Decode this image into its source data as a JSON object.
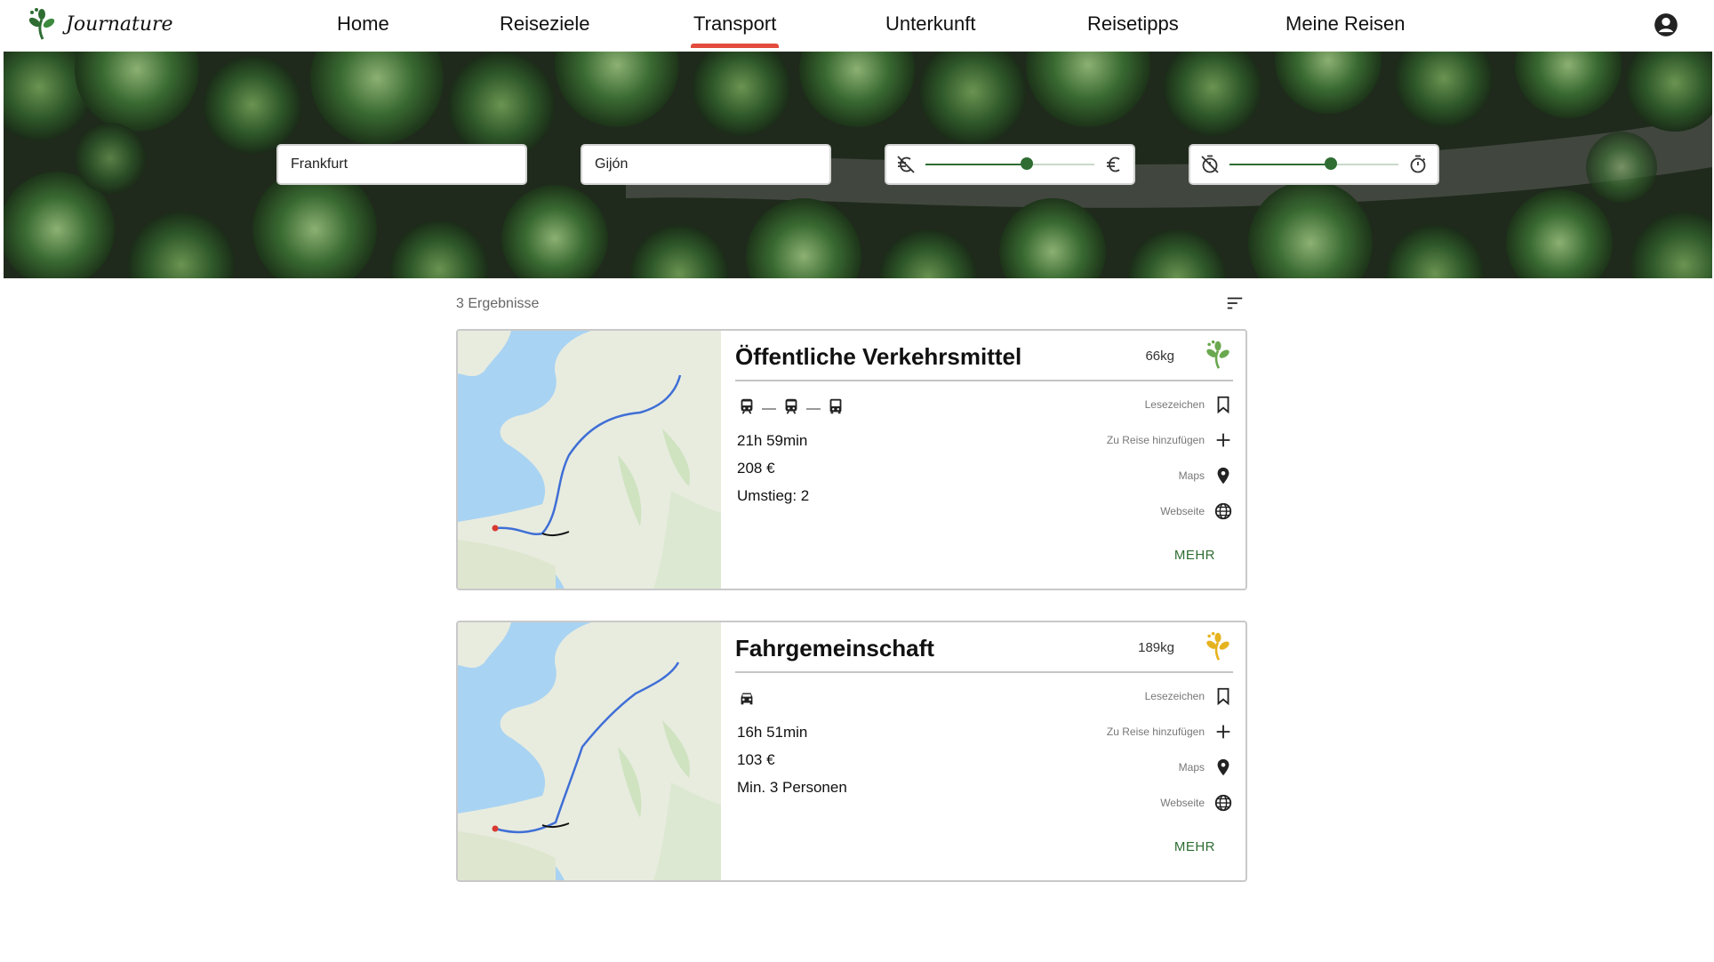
{
  "brand": {
    "name": "Journature",
    "logo_icon": "footprint-leaf-icon"
  },
  "nav": {
    "items": [
      {
        "label": "Home"
      },
      {
        "label": "Reiseziele"
      },
      {
        "label": "Transport"
      },
      {
        "label": "Unterkunft"
      },
      {
        "label": "Reisetipps"
      },
      {
        "label": "Meine Reisen"
      }
    ],
    "active": "Transport",
    "account_icon": "account-circle-icon"
  },
  "search": {
    "from_value": "Frankfurt",
    "to_value": "Gijón",
    "price_slider": {
      "min_icon": "no-money-icon",
      "max_icon": "euro-icon",
      "value_fraction": 0.6
    },
    "time_slider": {
      "min_icon": "timer-off-icon",
      "max_icon": "timer-icon",
      "value_fraction": 0.6
    }
  },
  "results": {
    "count_label": "3 Ergebnisse",
    "sort_icon": "sort-icon",
    "items": [
      {
        "title": "Öffentliche Verkehrsmittel",
        "co2": "66kg",
        "leaf_color": "#6aa84f",
        "modes": [
          "train-icon",
          "train-icon",
          "bus-icon"
        ],
        "duration": "21h 59min",
        "price": "208 €",
        "extra": "Umstieg: 2",
        "actions": {
          "bookmark": "Lesezeichen",
          "add": "Zu Reise hinzufügen",
          "maps": "Maps",
          "website": "Webseite"
        },
        "more": "MEHR"
      },
      {
        "title": "Fahrgemeinschaft",
        "co2": "189kg",
        "leaf_color": "#e6b320",
        "modes": [
          "car-icon"
        ],
        "duration": "16h 51min",
        "price": "103 €",
        "extra": "Min. 3 Personen",
        "actions": {
          "bookmark": "Lesezeichen",
          "add": "Zu Reise hinzufügen",
          "maps": "Maps",
          "website": "Webseite"
        },
        "more": "MEHR"
      }
    ]
  },
  "colors": {
    "accent_green": "#2f6d33",
    "active_tab": "#e34b3c"
  }
}
